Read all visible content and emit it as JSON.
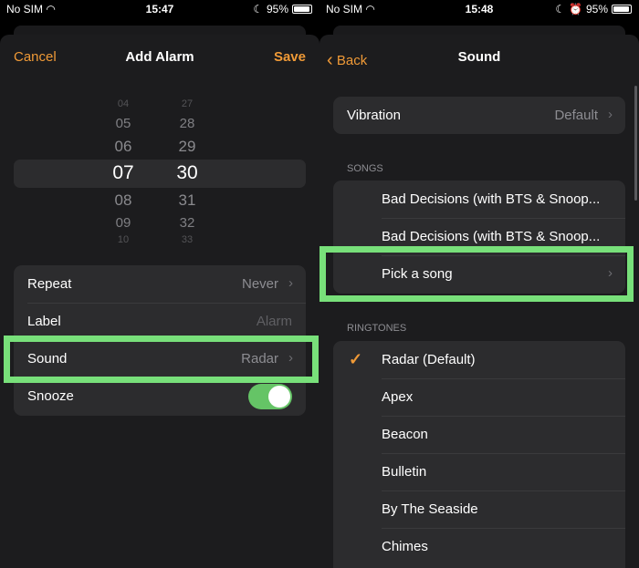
{
  "left": {
    "status": {
      "carrier": "No SIM",
      "time": "15:47",
      "battery": "95%"
    },
    "nav": {
      "cancel": "Cancel",
      "title": "Add Alarm",
      "save": "Save"
    },
    "picker": {
      "hours": [
        "04",
        "05",
        "06",
        "07",
        "08",
        "09",
        "10"
      ],
      "minutes": [
        "27",
        "28",
        "29",
        "30",
        "31",
        "32",
        "33"
      ],
      "selected_hour": "07",
      "selected_minute": "30"
    },
    "settings": [
      {
        "label": "Repeat",
        "value": "Never"
      },
      {
        "label": "Label",
        "value": "Alarm"
      },
      {
        "label": "Sound",
        "value": "Radar"
      },
      {
        "label": "Snooze",
        "value": true
      }
    ]
  },
  "right": {
    "status": {
      "carrier": "No SIM",
      "time": "15:48",
      "battery": "95%"
    },
    "nav": {
      "back": "Back",
      "title": "Sound"
    },
    "vibration": {
      "label": "Vibration",
      "value": "Default"
    },
    "songs_header": "SONGS",
    "songs": [
      "Bad Decisions (with BTS & Snoop...",
      "Bad Decisions (with BTS & Snoop...",
      "Pick a song"
    ],
    "ringtones_header": "RINGTONES",
    "ringtones": [
      "Radar (Default)",
      "Apex",
      "Beacon",
      "Bulletin",
      "By The Seaside",
      "Chimes"
    ],
    "selected_ringtone": "Radar (Default)"
  },
  "colors": {
    "accent": "#f09a37",
    "highlight": "#78e07a",
    "toggle_on": "#65c466"
  }
}
